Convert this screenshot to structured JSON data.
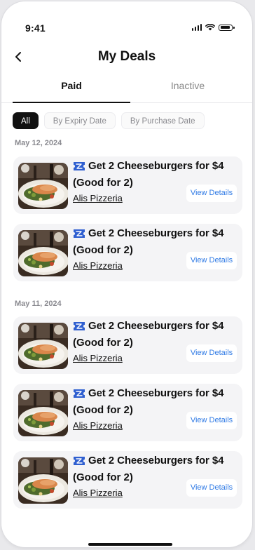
{
  "status_bar": {
    "time": "9:41"
  },
  "header": {
    "title": "My Deals"
  },
  "tabs": [
    {
      "label": "Paid",
      "active": true
    },
    {
      "label": "Inactive",
      "active": false
    }
  ],
  "filters": [
    {
      "label": "All",
      "active": true
    },
    {
      "label": "By Expiry Date",
      "active": false
    },
    {
      "label": "By Purchase Date",
      "active": false
    }
  ],
  "groups": [
    {
      "date": "May 12, 2024",
      "deals": [
        {
          "title": "Get 2 Cheeseburgers for $4",
          "subtitle": "(Good for 2)",
          "store": "Alis Pizzeria",
          "button": "View Details"
        },
        {
          "title": "Get 2 Cheeseburgers for $4",
          "subtitle": "(Good for 2)",
          "store": "Alis Pizzeria",
          "button": "View Details"
        }
      ]
    },
    {
      "date": "May 11, 2024",
      "deals": [
        {
          "title": "Get 2 Cheeseburgers for $4",
          "subtitle": "(Good for 2)",
          "store": "Alis Pizzeria",
          "button": "View Details"
        },
        {
          "title": "Get 2 Cheeseburgers for $4",
          "subtitle": "(Good for 2)",
          "store": "Alis Pizzeria",
          "button": "View Details"
        },
        {
          "title": "Get 2 Cheeseburgers for $4",
          "subtitle": "(Good for 2)",
          "store": "Alis Pizzeria",
          "button": "View Details"
        }
      ]
    }
  ],
  "colors": {
    "accent": "#2f7ae5",
    "card_bg": "#f4f4f6"
  },
  "icons": [
    "signal-icon",
    "wifi-icon",
    "battery-icon",
    "back-arrow-icon",
    "ticket-icon"
  ]
}
